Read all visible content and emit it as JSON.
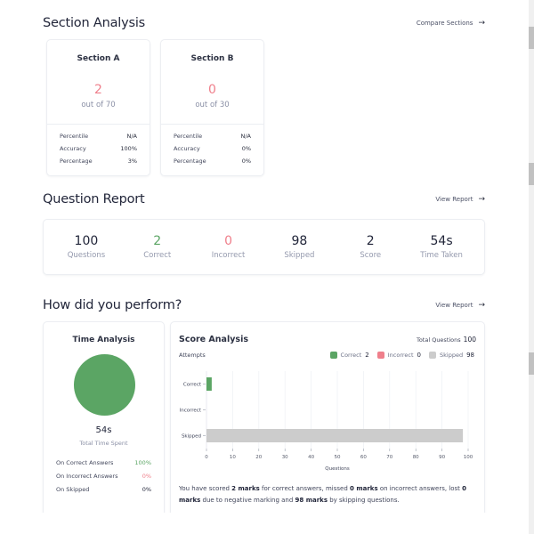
{
  "section_analysis": {
    "title": "Section Analysis",
    "link_label": "Compare Sections",
    "sections": [
      {
        "name": "Section A",
        "score": "2",
        "out_of": "out of 70",
        "stats": [
          {
            "label": "Percentile",
            "value": "N/A"
          },
          {
            "label": "Accuracy",
            "value": "100%"
          },
          {
            "label": "Percentage",
            "value": "3%"
          }
        ]
      },
      {
        "name": "Section B",
        "score": "0",
        "out_of": "out of 30",
        "stats": [
          {
            "label": "Percentile",
            "value": "N/A"
          },
          {
            "label": "Accuracy",
            "value": "0%"
          },
          {
            "label": "Percentage",
            "value": "0%"
          }
        ]
      }
    ]
  },
  "question_report": {
    "title": "Question Report",
    "link_label": "View Report",
    "items": [
      {
        "value": "100",
        "label": "Questions",
        "color": "#22263a"
      },
      {
        "value": "2",
        "label": "Correct",
        "color": "#5ba564"
      },
      {
        "value": "0",
        "label": "Incorrect",
        "color": "#ef7f8b"
      },
      {
        "value": "98",
        "label": "Skipped",
        "color": "#22263a"
      },
      {
        "value": "2",
        "label": "Score",
        "color": "#22263a"
      },
      {
        "value": "54s",
        "label": "Time Taken",
        "color": "#22263a"
      }
    ]
  },
  "performance": {
    "title": "How did you perform?",
    "link_label": "View Report",
    "time_analysis": {
      "title": "Time Analysis",
      "total_time": "54s",
      "total_label": "Total Time Spent",
      "pie_color": "#5ba564",
      "rows": [
        {
          "label": "On Correct Answers",
          "value": "100%",
          "color": "#5ba564"
        },
        {
          "label": "On Incorrect Answers",
          "value": "0%",
          "color": "#ef7f8b"
        },
        {
          "label": "On Skipped",
          "value": "0%",
          "color": "#22263a"
        }
      ]
    },
    "score_analysis": {
      "title": "Score Analysis",
      "total_questions_label": "Total Questions",
      "total_questions_value": "100",
      "attempts_label": "Attempts",
      "legend": [
        {
          "label": "Correct",
          "value": "2",
          "color": "#5ba564"
        },
        {
          "label": "Incorrect",
          "value": "0",
          "color": "#ef7f8b"
        },
        {
          "label": "Skipped",
          "value": "98",
          "color": "#cccccc"
        }
      ],
      "summary": {
        "p1": "You have scored ",
        "b1": "2 marks",
        "p2": " for correct answers, missed ",
        "b2": "0 marks",
        "p3": " on incorrect answers, lost ",
        "b3": "0 marks",
        "p4": " due to negative marking and ",
        "b4": "98 marks",
        "p5": " by skipping questions."
      }
    }
  },
  "chart_data": {
    "type": "bar",
    "orientation": "horizontal",
    "title": "Attempts",
    "categories": [
      "Correct",
      "Incorrect",
      "Skipped"
    ],
    "values": [
      2,
      0,
      98
    ],
    "colors": [
      "#5ba564",
      "#ef7f8b",
      "#cccccc"
    ],
    "xlabel": "Questions",
    "ylabel": "",
    "xlim": [
      0,
      100
    ],
    "xticks": [
      0,
      10,
      20,
      30,
      40,
      50,
      60,
      70,
      80,
      90,
      100
    ],
    "grid": true,
    "legend": "top-right"
  }
}
